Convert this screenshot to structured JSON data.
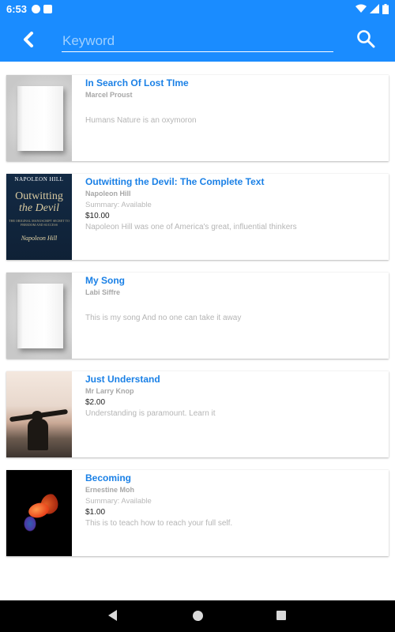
{
  "status_bar": {
    "time": "6:53"
  },
  "search": {
    "placeholder": "Keyword",
    "value": ""
  },
  "colors": {
    "accent": "#1a8cff",
    "title": "#1a80e6"
  },
  "books": [
    {
      "title": "In Search Of Lost TIme",
      "author": "Marcel Proust",
      "summary": "",
      "price": "",
      "description": "Humans Nature is an oxymoron",
      "cover": "blank-book"
    },
    {
      "title": "Outwitting the Devil: The Complete Text",
      "author": "Napoleon Hill",
      "summary": "Summary: Available",
      "price": "$10.00",
      "description": "Napoleon Hill was one of America's great, influential thinkers",
      "cover": "outwitting-cover",
      "cover_text": {
        "author": "NAPOLEON HILL",
        "title_line1": "Outwitting",
        "title_line2": "the Devil",
        "subtitle": "THE ORIGINAL MANUSCRIPT SECRET TO FREEDOM AND SUCCESS",
        "signature": "Napoleon Hill"
      }
    },
    {
      "title": "My Song",
      "author": "Labi Siffre",
      "summary": "",
      "price": "",
      "description": "This is my song And no one can take it away",
      "cover": "blank-book"
    },
    {
      "title": "Just Understand",
      "author": "Mr Larry Knop",
      "summary": "",
      "price": "$2.00",
      "description": "Understanding is paramount. Learn it",
      "cover": "person-photo"
    },
    {
      "title": "Becoming",
      "author": "Ernestine Moh",
      "summary": "Summary: Available",
      "price": "$1.00",
      "description": "This is to teach how to reach your full self.",
      "cover": "goldfish-photo"
    }
  ]
}
